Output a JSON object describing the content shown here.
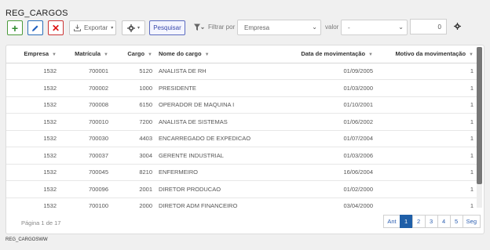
{
  "page": {
    "title": "REG_CARGOS",
    "bottom_label": "REG_CARGOSWW"
  },
  "toolbar": {
    "add_label": "+",
    "delete_label": "✕",
    "export_label": "Exportar",
    "search_label": "Pesquisar",
    "filter_label": "Filtrar por",
    "filter_field": "Empresa",
    "value_label": "valor",
    "value_select": "-",
    "number_value": "0"
  },
  "table": {
    "columns": [
      "Empresa",
      "Matrícula",
      "Cargo",
      "Nome do cargo",
      "Data de movimentação",
      "Motivo da movimentação"
    ],
    "rows": [
      [
        "1532",
        "700001",
        "5120",
        "ANALISTA DE RH",
        "01/09/2005",
        "1"
      ],
      [
        "1532",
        "700002",
        "1000",
        "PRESIDENTE",
        "01/03/2000",
        "1"
      ],
      [
        "1532",
        "700008",
        "6150",
        "OPERADOR DE MAQUINA I",
        "01/10/2001",
        "1"
      ],
      [
        "1532",
        "700010",
        "7200",
        "ANALISTA DE SISTEMAS",
        "01/06/2002",
        "1"
      ],
      [
        "1532",
        "700030",
        "4403",
        "ENCARREGADO DE EXPEDICAO",
        "01/07/2004",
        "1"
      ],
      [
        "1532",
        "700037",
        "3004",
        "GERENTE INDUSTRIAL",
        "01/03/2006",
        "1"
      ],
      [
        "1532",
        "700045",
        "8210",
        "ENFERMEIRO",
        "16/06/2004",
        "1"
      ],
      [
        "1532",
        "700096",
        "2001",
        "DIRETOR PRODUCAO",
        "01/02/2000",
        "1"
      ],
      [
        "1532",
        "700100",
        "2000",
        "DIRETOR ADM FINANCEIRO",
        "03/04/2000",
        "1"
      ]
    ]
  },
  "footer": {
    "page_info": "Página 1 de 17",
    "pager": {
      "prev": "Ant",
      "pages": [
        "1",
        "2",
        "3",
        "4",
        "5"
      ],
      "next": "Seg",
      "active": "1"
    }
  },
  "colors": {
    "accent": "#1f5fa8",
    "add": "#2e8b2e",
    "edit": "#1e5fbf",
    "delete": "#dd1111"
  }
}
